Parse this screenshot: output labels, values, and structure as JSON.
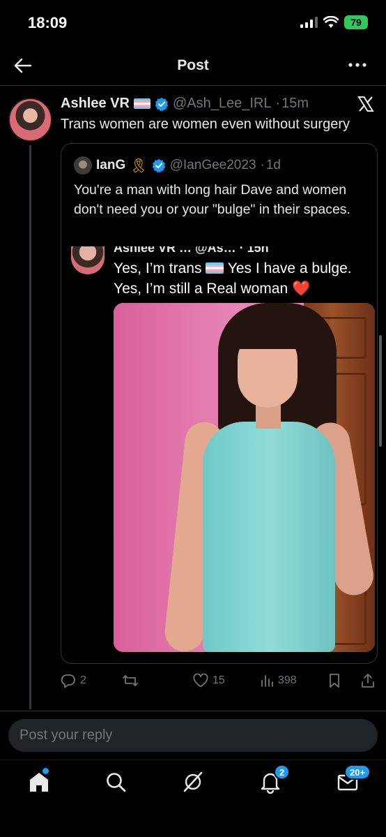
{
  "status_bar": {
    "time": "18:09",
    "battery": "79"
  },
  "header": {
    "title": "Post"
  },
  "post": {
    "author_name": "Ashlee VR",
    "handle": "@Ash_Lee_IRL",
    "time": "15m",
    "text": "Trans women are women even without surgery",
    "quote": {
      "author_name": "IanG",
      "handle": "@IanGee2023",
      "time": "1d",
      "text": "You're a man with long hair Dave and women don't need you or your \"bulge\" in their spaces.",
      "embedded": {
        "header_cut": "Ashlee VR … @As… · 15h",
        "line1_a": "Yes, I’m trans",
        "line1_b": "Yes I have a bulge.",
        "line2": "Yes, I’m still a Real woman",
        "heart": "❤️"
      }
    },
    "actions": {
      "replies": "2",
      "likes": "15",
      "views": "398"
    }
  },
  "reply": {
    "placeholder": "Post your reply"
  },
  "tabbar": {
    "notifications_badge": "2",
    "messages_badge": "20+"
  },
  "colors": {
    "accent": "#1d9bf0",
    "background": "#000000",
    "muted": "#71767b",
    "battery": "#34c759"
  },
  "icons": [
    "back-arrow-icon",
    "more-icon",
    "verified-icon",
    "x-logo-icon",
    "reply-icon",
    "repost-icon",
    "like-icon",
    "views-icon",
    "bookmark-icon",
    "share-icon",
    "home-icon",
    "search-icon",
    "grok-icon",
    "bell-icon",
    "mail-icon"
  ]
}
